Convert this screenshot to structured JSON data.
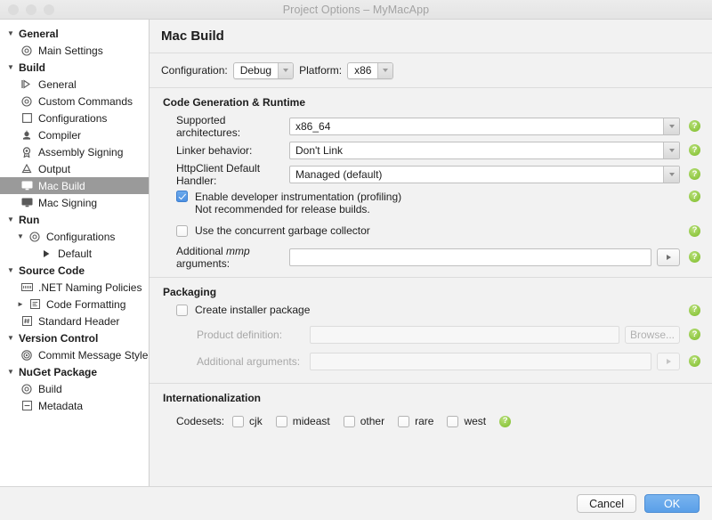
{
  "window": {
    "title": "Project Options – MyMacApp",
    "traffic_lights": [
      "close-button",
      "minimize-button",
      "zoom-button"
    ]
  },
  "sidebar": {
    "groups": [
      {
        "label": "General",
        "expanded": true,
        "items": [
          {
            "label": "Main Settings",
            "icon": "gear-icon",
            "selected": false,
            "indent": 0,
            "disclosure": ""
          }
        ]
      },
      {
        "label": "Build",
        "expanded": true,
        "items": [
          {
            "label": "General",
            "icon": "play-outline-icon",
            "selected": false,
            "indent": 0,
            "disclosure": ""
          },
          {
            "label": "Custom Commands",
            "icon": "gear-icon",
            "selected": false,
            "indent": 0,
            "disclosure": ""
          },
          {
            "label": "Configurations",
            "icon": "square-icon",
            "selected": false,
            "indent": 0,
            "disclosure": ""
          },
          {
            "label": "Compiler",
            "icon": "compiler-icon",
            "selected": false,
            "indent": 0,
            "disclosure": ""
          },
          {
            "label": "Assembly Signing",
            "icon": "seal-icon",
            "selected": false,
            "indent": 0,
            "disclosure": ""
          },
          {
            "label": "Output",
            "icon": "output-icon",
            "selected": false,
            "indent": 0,
            "disclosure": ""
          },
          {
            "label": "Mac Build",
            "icon": "monitor-icon",
            "selected": true,
            "indent": 0,
            "disclosure": ""
          },
          {
            "label": "Mac Signing",
            "icon": "monitor-icon",
            "selected": false,
            "indent": 0,
            "disclosure": ""
          }
        ]
      },
      {
        "label": "Run",
        "expanded": true,
        "items": [
          {
            "label": "Configurations",
            "icon": "gear-icon",
            "selected": false,
            "indent": 1,
            "disclosure": "▼"
          },
          {
            "label": "Default",
            "icon": "triangle-right-icon",
            "selected": false,
            "indent": 2,
            "disclosure": ""
          }
        ]
      },
      {
        "label": "Source Code",
        "expanded": true,
        "items": [
          {
            "label": ".NET Naming Policies",
            "icon": "naming-icon",
            "selected": false,
            "indent": 0,
            "disclosure": ""
          },
          {
            "label": "Code Formatting",
            "icon": "format-icon",
            "selected": false,
            "indent": 1,
            "disclosure": "►"
          },
          {
            "label": "Standard Header",
            "icon": "hash-icon",
            "selected": false,
            "indent": 0,
            "disclosure": ""
          }
        ]
      },
      {
        "label": "Version Control",
        "expanded": true,
        "items": [
          {
            "label": "Commit Message Style",
            "icon": "target-icon",
            "selected": false,
            "indent": 0,
            "disclosure": ""
          }
        ]
      },
      {
        "label": "NuGet Package",
        "expanded": true,
        "items": [
          {
            "label": "Build",
            "icon": "gear-icon",
            "selected": false,
            "indent": 0,
            "disclosure": ""
          },
          {
            "label": "Metadata",
            "icon": "metadata-icon",
            "selected": false,
            "indent": 0,
            "disclosure": ""
          }
        ]
      }
    ]
  },
  "main": {
    "page_title": "Mac Build",
    "toolbar": {
      "configuration_label": "Configuration:",
      "configuration_value": "Debug",
      "platform_label": "Platform:",
      "platform_value": "x86"
    },
    "sections": {
      "code_generation": {
        "header": "Code Generation & Runtime",
        "supported_architectures_label": "Supported architectures:",
        "supported_architectures_value": "x86_64",
        "linker_behavior_label": "Linker behavior:",
        "linker_behavior_value": "Don't Link",
        "httpclient_label": "HttpClient Default Handler:",
        "httpclient_value": "Managed (default)",
        "dev_instrumentation_label": "Enable developer instrumentation (profiling)",
        "dev_instrumentation_sub": "Not recommended for release builds.",
        "dev_instrumentation_checked": true,
        "concurrent_gc_label": "Use the concurrent garbage collector",
        "concurrent_gc_checked": false,
        "mmp_label_pre": "Additional ",
        "mmp_label_em": "mmp",
        "mmp_label_post": " arguments:",
        "mmp_value": ""
      },
      "packaging": {
        "header": "Packaging",
        "create_installer_label": "Create installer package",
        "create_installer_checked": false,
        "product_definition_label": "Product definition:",
        "product_definition_value": "",
        "browse_label": "Browse...",
        "additional_arguments_label": "Additional arguments:",
        "additional_arguments_value": ""
      },
      "internationalization": {
        "header": "Internationalization",
        "codesets_label": "Codesets:",
        "codesets": [
          {
            "label": "cjk",
            "checked": false
          },
          {
            "label": "mideast",
            "checked": false
          },
          {
            "label": "other",
            "checked": false
          },
          {
            "label": "rare",
            "checked": false
          },
          {
            "label": "west",
            "checked": false
          }
        ]
      }
    },
    "help_glyph": "?"
  },
  "footer": {
    "cancel_label": "Cancel",
    "ok_label": "OK"
  },
  "colors": {
    "accent": "#5a9fe8",
    "help_green": "#8dc63f",
    "selection_gray": "#9a9a9a",
    "content_bg": "#f2f2f2"
  }
}
